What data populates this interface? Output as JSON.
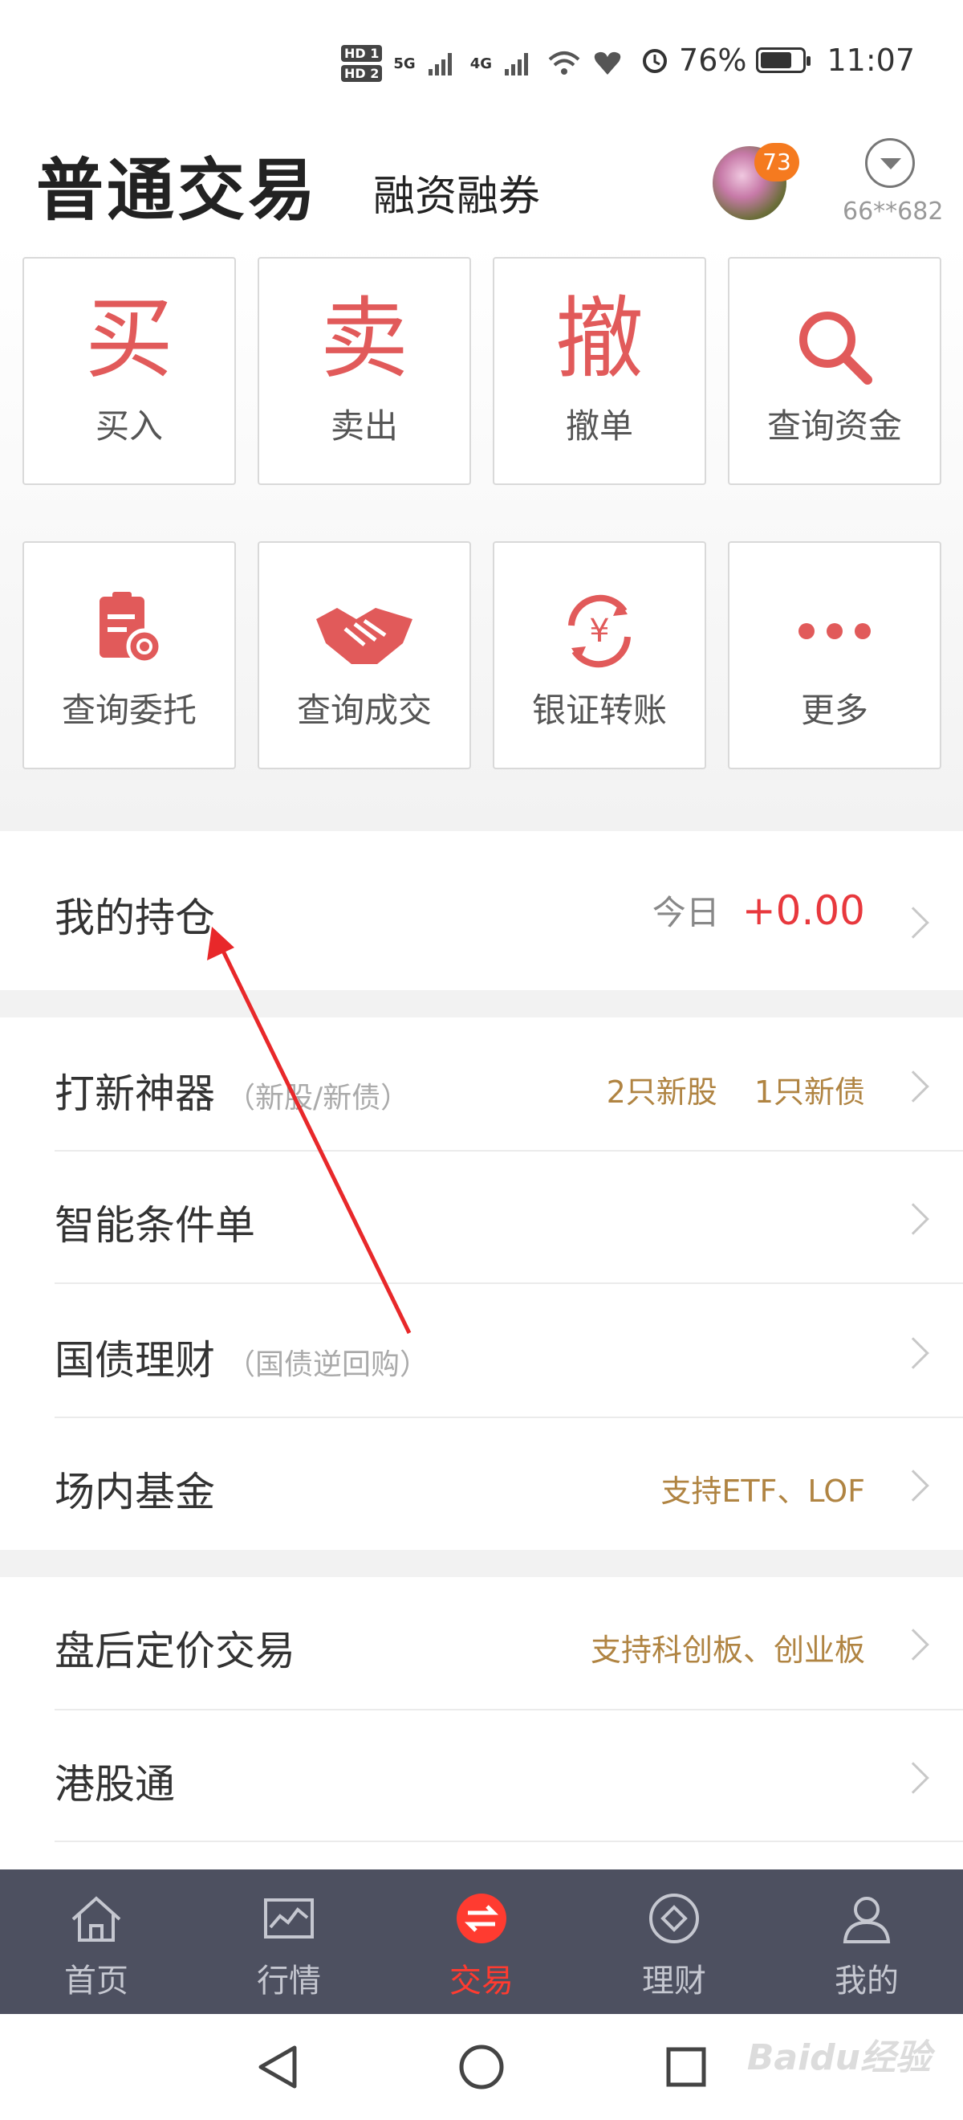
{
  "status_bar": {
    "hd1": "HD 1",
    "hd2": "HD 2",
    "net": "5G",
    "net2": "4G",
    "battery_pct": "76%",
    "battery_level": 0.76,
    "time": "11:07"
  },
  "header": {
    "title": "普通交易",
    "subtitle": "融资融券",
    "badge_count": "73",
    "account_id": "66**682"
  },
  "quick_actions": [
    {
      "glyph": "买",
      "label": "买入",
      "icon": "buy-glyph"
    },
    {
      "glyph": "卖",
      "label": "卖出",
      "icon": "sell-glyph"
    },
    {
      "glyph": "撤",
      "label": "撤单",
      "icon": "cancel-glyph"
    },
    {
      "glyph": "",
      "label": "查询资金",
      "icon": "search-icon"
    },
    {
      "glyph": "",
      "label": "查询委托",
      "icon": "clipboard-search-icon"
    },
    {
      "glyph": "",
      "label": "查询成交",
      "icon": "handshake-icon"
    },
    {
      "glyph": "",
      "label": "银证转账",
      "icon": "yuan-transfer-icon"
    },
    {
      "glyph": "",
      "label": "更多",
      "icon": "more-dots-icon"
    }
  ],
  "holdings": {
    "label": "我的持仓",
    "today_label": "今日",
    "today_value": "+0.00"
  },
  "menu": [
    {
      "label": "打新神器",
      "hint": "（新股/新债）",
      "right1": "2只新股",
      "right2": "1只新债"
    },
    {
      "label": "智能条件单",
      "hint": "",
      "right1": "",
      "right2": ""
    },
    {
      "label": "国债理财",
      "hint": "（国债逆回购）",
      "right1": "",
      "right2": ""
    },
    {
      "label": "场内基金",
      "hint": "",
      "right1": "支持ETF、LOF",
      "right2": ""
    },
    {
      "label": "盘后定价交易",
      "hint": "",
      "right1": "支持科创板、创业板",
      "right2": ""
    },
    {
      "label": "港股通",
      "hint": "",
      "right1": "",
      "right2": ""
    }
  ],
  "tabs": [
    {
      "label": "首页",
      "icon": "home-icon"
    },
    {
      "label": "行情",
      "icon": "chart-icon"
    },
    {
      "label": "交易",
      "icon": "exchange-icon"
    },
    {
      "label": "理财",
      "icon": "wealth-icon"
    },
    {
      "label": "我的",
      "icon": "user-icon"
    }
  ],
  "active_tab": "交易",
  "watermark": "Baidu经验",
  "colors": {
    "accent_red": "#e15a5a",
    "value_red": "#e8383d",
    "gold_text": "#b08442",
    "tabbar_bg": "#4d5060",
    "active_tab": "#ff3b30"
  }
}
